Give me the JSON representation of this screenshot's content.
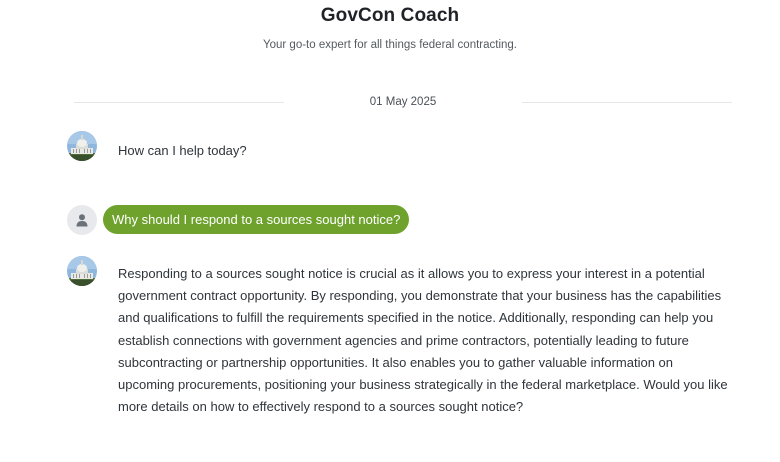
{
  "header": {
    "title": "GovCon Coach",
    "subtitle": "Your go-to expert for all things federal contracting."
  },
  "conversation": {
    "date": "01 May 2025",
    "messages": [
      {
        "role": "assistant",
        "avatar_icon": "capitol-building-icon",
        "text": "How can I help today?"
      },
      {
        "role": "user",
        "avatar_icon": "user-icon",
        "text": "Why should I respond to a sources sought notice?"
      },
      {
        "role": "assistant",
        "avatar_icon": "capitol-building-icon",
        "text": "Responding to a sources sought notice is crucial as it allows you to express your interest in a potential government contract opportunity. By responding, you demonstrate that your business has the capabilities and qualifications to fulfill the requirements specified in the notice. Additionally, responding can help you establish connections with government agencies and prime contractors, potentially leading to future subcontracting or partnership opportunities. It also enables you to gather valuable information on upcoming procurements, positioning your business strategically in the federal marketplace. Would you like more details on how to effectively respond to a sources sought notice?"
      }
    ]
  },
  "colors": {
    "user_bubble": "#6ea22d",
    "user_bubble_text": "#ffffff",
    "divider": "#e5e7ea"
  }
}
